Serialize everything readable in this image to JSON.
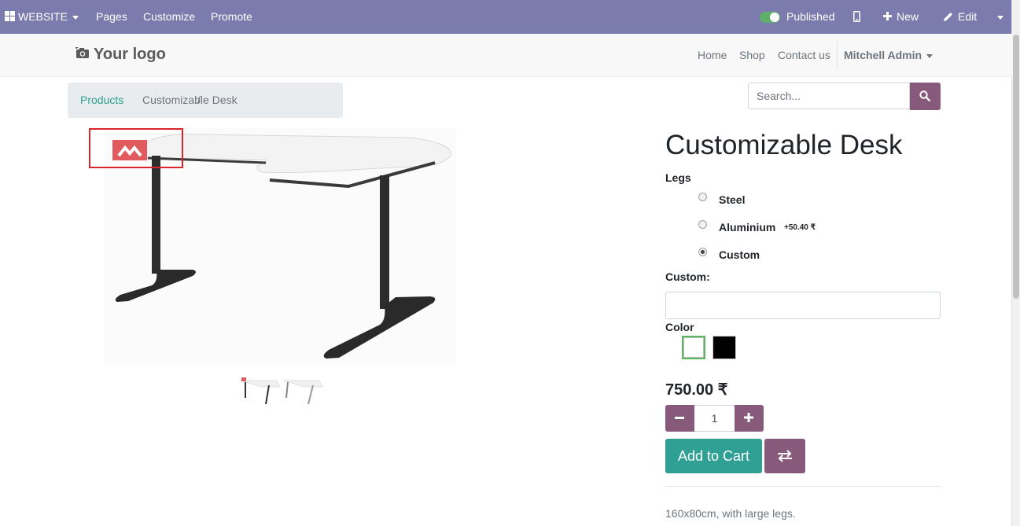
{
  "topbar": {
    "website_label": "WEBSITE",
    "menu": [
      "Pages",
      "Customize",
      "Promote"
    ],
    "published_label": "Published",
    "new_label": "New",
    "edit_label": "Edit"
  },
  "navbar": {
    "logo": "Your logo",
    "links": [
      "Home",
      "Shop",
      "Contact us"
    ],
    "user": "Mitchell Admin"
  },
  "breadcrumb": {
    "parent": "Products",
    "separator": "/",
    "current": "Customizable Desk"
  },
  "search": {
    "placeholder": "Search..."
  },
  "product": {
    "title": "Customizable Desk",
    "attr_legs_label": "Legs",
    "legs_options": [
      {
        "label": "Steel",
        "extra": "",
        "checked": false
      },
      {
        "label": "Aluminium",
        "extra": "+50.40 ₹",
        "checked": false
      },
      {
        "label": "Custom",
        "extra": "",
        "checked": true
      }
    ],
    "custom_label": "Custom:",
    "custom_value": "",
    "color_label": "Color",
    "colors": [
      {
        "name": "white",
        "hex": "#ffffff",
        "selected": true
      },
      {
        "name": "black",
        "hex": "#000000",
        "selected": false
      }
    ],
    "price": "750.00 ₹",
    "quantity": "1",
    "add_to_cart": "Add to Cart",
    "description": "160x80cm, with large legs."
  },
  "colors": {
    "topbar": "#7c7bad",
    "primary": "#875a7b",
    "accent": "#30a095",
    "highlight_box": "#d9262b"
  }
}
